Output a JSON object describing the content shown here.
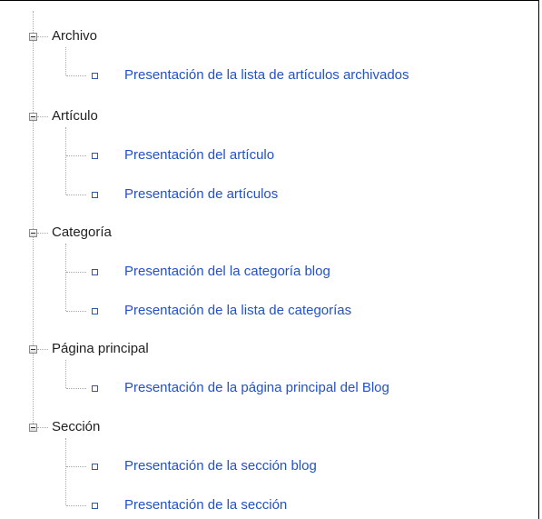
{
  "tree": {
    "categories": [
      {
        "label": "Archivo",
        "items": [
          "Presentación de la lista de artículos archivados"
        ]
      },
      {
        "label": "Artículo",
        "items": [
          "Presentación del artículo",
          "Presentación de artículos"
        ]
      },
      {
        "label": "Categoría",
        "items": [
          "Presentación del la categoría blog",
          "Presentación de la lista de categorías"
        ]
      },
      {
        "label": "Página principal",
        "items": [
          "Presentación de la página principal del Blog"
        ]
      },
      {
        "label": "Sección",
        "items": [
          "Presentación de la sección blog",
          "Presentación de la sección"
        ]
      }
    ]
  }
}
